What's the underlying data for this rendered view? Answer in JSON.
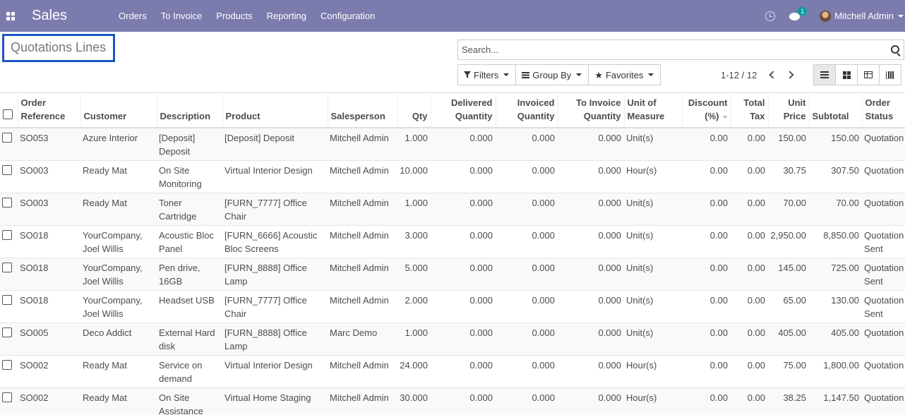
{
  "navbar": {
    "app_name": "Sales",
    "menu": [
      "Orders",
      "To Invoice",
      "Products",
      "Reporting",
      "Configuration"
    ],
    "chat_count": "1",
    "user_name": "Mitchell Admin",
    "color": "#7c7bad"
  },
  "control": {
    "title": "Quotations Lines",
    "search_placeholder": "Search...",
    "filters_label": "Filters",
    "groupby_label": "Group By",
    "favorites_label": "Favorites",
    "pager": "1-12 / 12",
    "active_view": "list"
  },
  "table": {
    "headers": [
      "Order Reference",
      "Customer",
      "Description",
      "Product",
      "Salesperson",
      "Qty",
      "Delivered Quantity",
      "Invoiced Quantity",
      "To Invoice Quantity",
      "Unit of Measure",
      "Discount (%)",
      "Total Tax",
      "Unit Price",
      "Subtotal",
      "Order Status"
    ],
    "rows": [
      [
        "SO053",
        "Azure Interior",
        "[Deposit] Deposit",
        "[Deposit] Deposit",
        "Mitchell Admin",
        "1.000",
        "0.000",
        "0.000",
        "0.000",
        "Unit(s)",
        "0.00",
        "0.00",
        "150.00",
        "150.00",
        "Quotation"
      ],
      [
        "SO003",
        "Ready Mat",
        "On Site Monitoring",
        "Virtual Interior Design",
        "Mitchell Admin",
        "10.000",
        "0.000",
        "0.000",
        "0.000",
        "Hour(s)",
        "0.00",
        "0.00",
        "30.75",
        "307.50",
        "Quotation"
      ],
      [
        "SO003",
        "Ready Mat",
        "Toner Cartridge",
        "[FURN_7777] Office Chair",
        "Mitchell Admin",
        "1.000",
        "0.000",
        "0.000",
        "0.000",
        "Unit(s)",
        "0.00",
        "0.00",
        "70.00",
        "70.00",
        "Quotation"
      ],
      [
        "SO018",
        "YourCompany, Joel Willis",
        "Acoustic Bloc Panel",
        "[FURN_6666] Acoustic Bloc Screens",
        "Mitchell Admin",
        "3.000",
        "0.000",
        "0.000",
        "0.000",
        "Unit(s)",
        "0.00",
        "0.00",
        "2,950.00",
        "8,850.00",
        "Quotation Sent"
      ],
      [
        "SO018",
        "YourCompany, Joel Willis",
        "Pen drive, 16GB",
        "[FURN_8888] Office Lamp",
        "Mitchell Admin",
        "5.000",
        "0.000",
        "0.000",
        "0.000",
        "Unit(s)",
        "0.00",
        "0.00",
        "145.00",
        "725.00",
        "Quotation Sent"
      ],
      [
        "SO018",
        "YourCompany, Joel Willis",
        "Headset USB",
        "[FURN_7777] Office Chair",
        "Mitchell Admin",
        "2.000",
        "0.000",
        "0.000",
        "0.000",
        "Unit(s)",
        "0.00",
        "0.00",
        "65.00",
        "130.00",
        "Quotation Sent"
      ],
      [
        "SO005",
        "Deco Addict",
        "External Hard disk",
        "[FURN_8888] Office Lamp",
        "Marc Demo",
        "1.000",
        "0.000",
        "0.000",
        "0.000",
        "Unit(s)",
        "0.00",
        "0.00",
        "405.00",
        "405.00",
        "Quotation"
      ],
      [
        "SO002",
        "Ready Mat",
        "Service on demand",
        "Virtual Interior Design",
        "Mitchell Admin",
        "24.000",
        "0.000",
        "0.000",
        "0.000",
        "Hour(s)",
        "0.00",
        "0.00",
        "75.00",
        "1,800.00",
        "Quotation"
      ],
      [
        "SO002",
        "Ready Mat",
        "On Site Assistance",
        "Virtual Home Staging",
        "Mitchell Admin",
        "30.000",
        "0.000",
        "0.000",
        "0.000",
        "Hour(s)",
        "0.00",
        "0.00",
        "38.25",
        "1,147.50",
        "Quotation"
      ]
    ]
  }
}
